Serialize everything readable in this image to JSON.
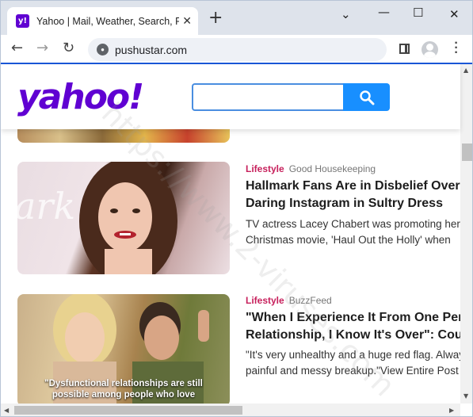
{
  "browser": {
    "tab_title": "Yahoo | Mail, Weather, Search, Politics",
    "close_tab": "✕",
    "new_tab": "+",
    "url": "pushustar.com",
    "window_controls": {
      "minimize": "⌄",
      "maximize_a": "—",
      "restore": "☐",
      "close": "✕"
    }
  },
  "page": {
    "logo": "yahoo!",
    "search_placeholder": "",
    "watermark": "https://www.2-viruses.com",
    "articles": [
      {
        "category": "Lifestyle",
        "source": "Good Housekeeping",
        "headline_1": "Hallmark Fans Are in Disbelief Over",
        "headline_2": "Daring Instagram in Sultry Dress",
        "summary_1": "TV actress Lacey Chabert was promoting her",
        "summary_2": "Christmas movie, 'Haul Out the Holly' when"
      },
      {
        "category": "Lifestyle",
        "source": "BuzzFeed",
        "headline_1": "\"When I Experience It From One Person In A",
        "headline_2": "Relationship, I Know It's Over\": Couples",
        "summary_1": "\"It's very unhealthy and a huge red flag. Always",
        "summary_2": "painful and messy breakup.\"View Entire Post",
        "image_caption": "\"Dysfunctional relationships are still possible among people who love"
      }
    ]
  },
  "colors": {
    "yahoo_purple": "#6001d2",
    "search_blue": "#188fff",
    "category_pink": "#c7205c",
    "accent_line": "#1a56d6"
  }
}
